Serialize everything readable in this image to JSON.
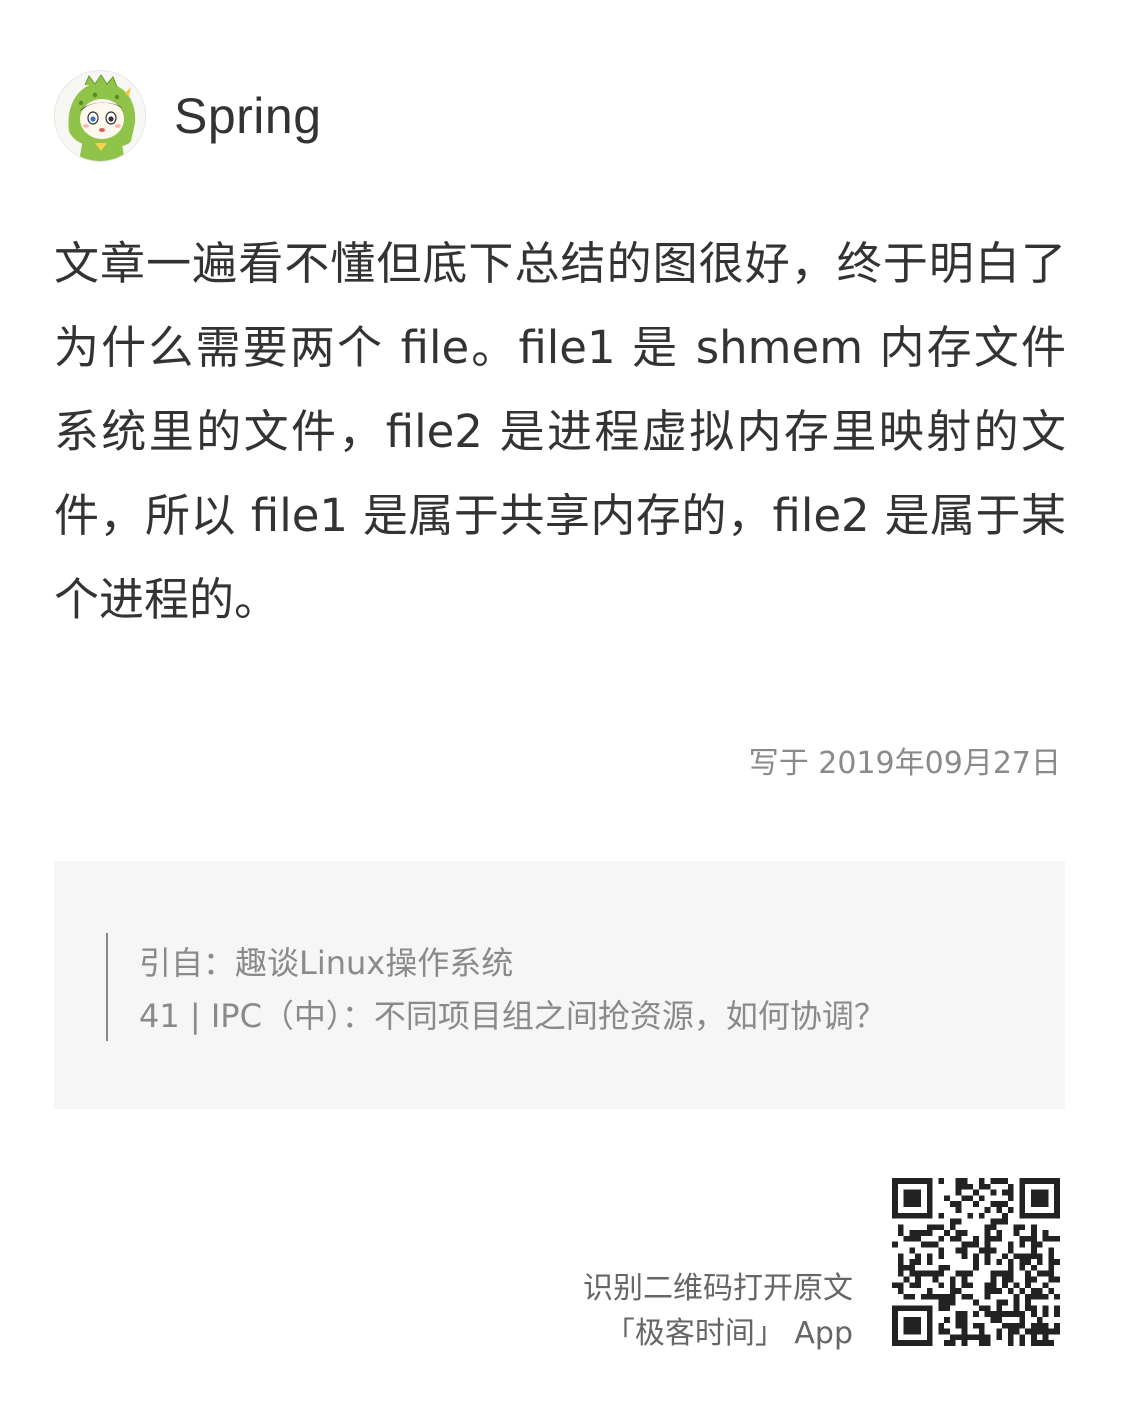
{
  "header": {
    "username": "Spring",
    "avatar_icon": "cartoon-dinosaur-avatar-icon"
  },
  "comment": {
    "text": "文章一遍看不懂但底下总结的图很好，终于明白了为什么需要两个 file。file1 是 shmem 内存文件系统里的文件，file2 是进程虚拟内存里映射的文件，所以 file1 是属于共享内存的，file2 是属于某个进程的。"
  },
  "date": {
    "label": "写于 2019年09月27日"
  },
  "quote": {
    "source_line": "引自：趣谈Linux操作系统",
    "article_line": "41 | IPC（中）：不同项目组之间抢资源，如何协调？"
  },
  "footer": {
    "line1": "识别二维码打开原文",
    "line2": "「极客时间」 App",
    "qr_icon": "qr-code-icon"
  },
  "colors": {
    "text_primary": "#333333",
    "text_secondary": "#8a8a8a",
    "quote_background": "#f6f6f6",
    "avatar_green": "#8fc34a"
  }
}
